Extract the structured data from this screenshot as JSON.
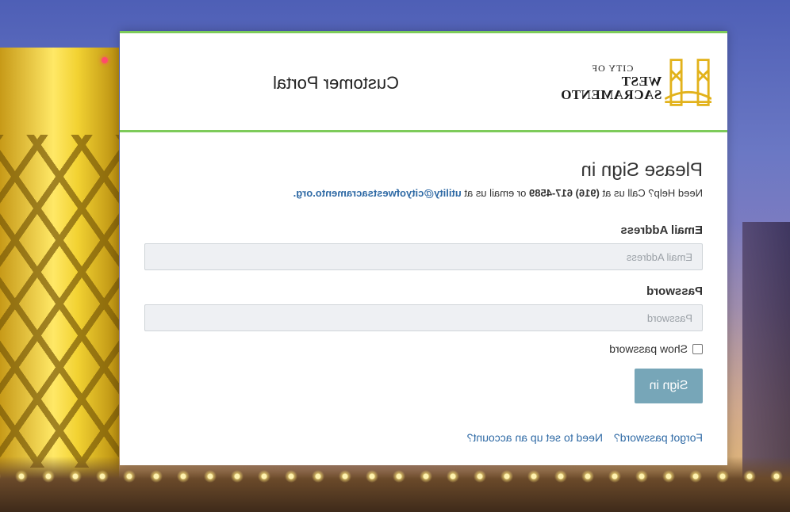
{
  "header": {
    "logo_small": "CITY OF",
    "logo_name": "WEST SACRAMENTO",
    "portal_title": "Customer Portal"
  },
  "signin": {
    "heading": "Please Sign in",
    "help_prefix": "Need Help? Call us at ",
    "help_phone": "(916) 617-4589",
    "help_middle": " or email us at ",
    "help_email": "utility@cityofwestsacramento.org."
  },
  "form": {
    "email_label": "Email Address",
    "email_placeholder": "Email Address",
    "email_value": "",
    "password_label": "Password",
    "password_placeholder": "Password",
    "password_value": "",
    "show_password_label": "Show password",
    "submit_label": "Sign in"
  },
  "links": {
    "forgot": "Forgot password?",
    "signup": "Need to set up an account?"
  },
  "colors": {
    "accent_green": "#7dcb5a",
    "button": "#77a6b8",
    "link": "#2f6aa5"
  }
}
